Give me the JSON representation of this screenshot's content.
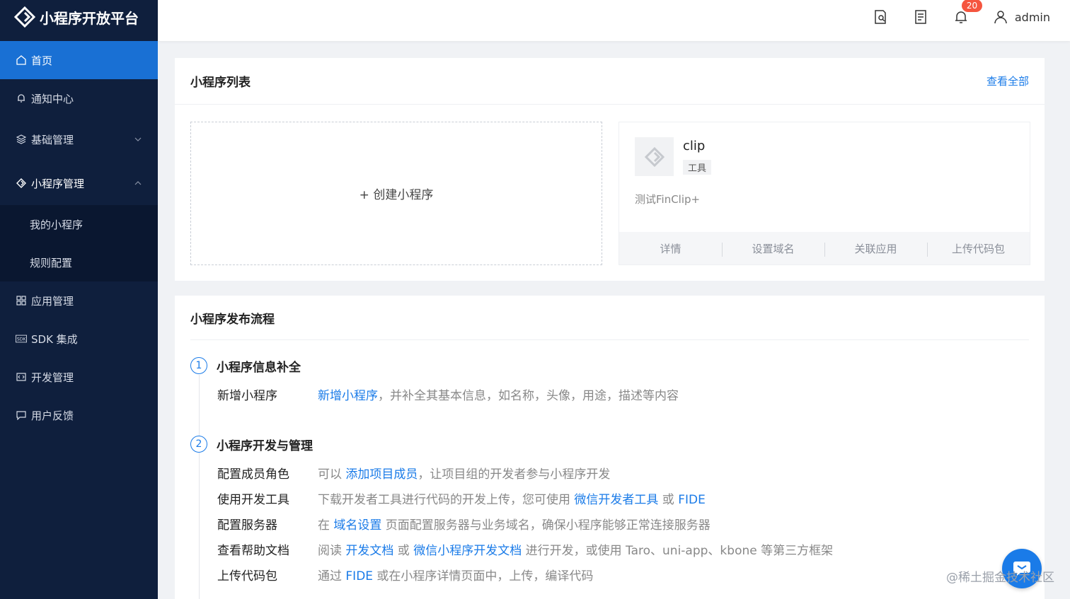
{
  "sidebar": {
    "logo": "小程序开放平台",
    "items": [
      {
        "label": "首页"
      },
      {
        "label": "通知中心"
      },
      {
        "label": "基础管理"
      },
      {
        "label": "小程序管理"
      },
      {
        "label": "应用管理"
      },
      {
        "label": "SDK 集成"
      },
      {
        "label": "开发管理"
      },
      {
        "label": "用户反馈"
      }
    ],
    "sub_items": [
      {
        "label": "我的小程序"
      },
      {
        "label": "规则配置"
      }
    ],
    "accent": "#1970d4",
    "bg": "#0f1f3d"
  },
  "topbar": {
    "badge": "20",
    "user": "admin"
  },
  "mp_list": {
    "title": "小程序列表",
    "view_all": "查看全部",
    "create": "+ 创建小程序",
    "app": {
      "name": "clip",
      "tag": "工具",
      "desc": "测试FinClip+",
      "actions": [
        "详情",
        "设置域名",
        "关联应用",
        "上传代码包"
      ]
    }
  },
  "flow": {
    "title": "小程序发布流程",
    "step1": {
      "num": "1",
      "title": "小程序信息补全",
      "rows": [
        {
          "k": "新增小程序",
          "link1": "新增小程序",
          "text1": "，并补全其基本信息，如名称，头像，用途，描述等内容"
        }
      ]
    },
    "step2": {
      "num": "2",
      "title": "小程序开发与管理",
      "rows": [
        {
          "k": "配置成员角色",
          "pre": "可以 ",
          "link1": "添加项目成员",
          "text1": "，让项目组的开发者参与小程序开发"
        },
        {
          "k": "使用开发工具",
          "pre": "下载开发者工具进行代码的开发上传，您可使用 ",
          "link1": "微信开发者工具",
          "mid": " 或 ",
          "link2": "FIDE"
        },
        {
          "k": "配置服务器",
          "pre": "在 ",
          "link1": "域名设置",
          "text1": " 页面配置服务器与业务域名，确保小程序能够正常连接服务器"
        },
        {
          "k": "查看帮助文档",
          "pre": "阅读 ",
          "link1": "开发文档",
          "mid": " 或 ",
          "link2": "微信小程序开发文档",
          "text2": " 进行开发，或使用 Taro、uni-app、kbone 等第三方框架"
        },
        {
          "k": "上传代码包",
          "pre": "通过 ",
          "link1": "FIDE",
          "text1": " 或在小程序详情页面中，上传，编译代码"
        }
      ]
    }
  },
  "watermark": "@稀土掘金技术社区",
  "link_color": "#1a7be8"
}
